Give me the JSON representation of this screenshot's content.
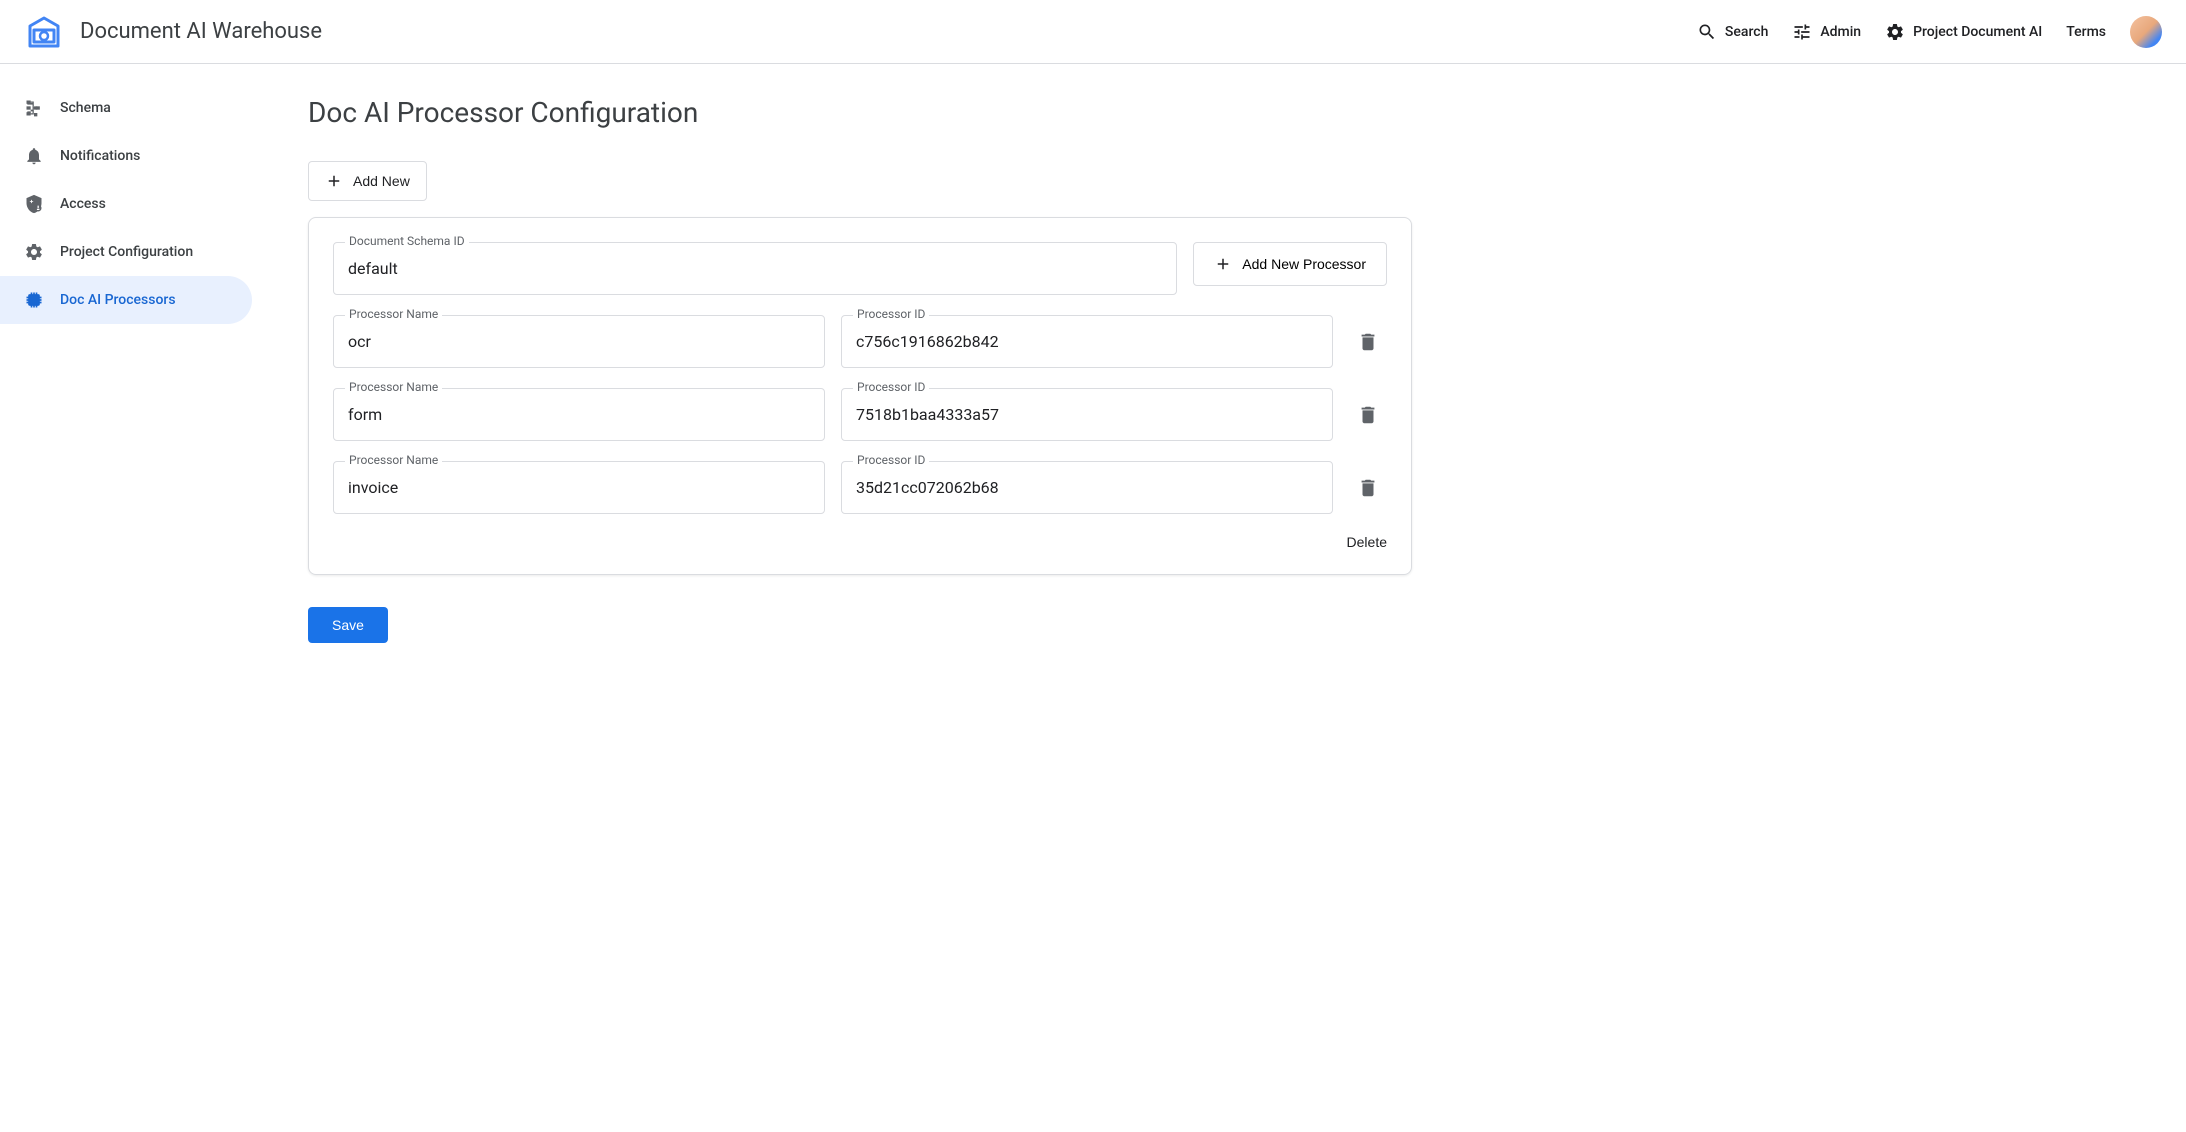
{
  "header": {
    "app_title": "Document AI Warehouse",
    "search_label": "Search",
    "admin_label": "Admin",
    "project_label": "Project Document AI",
    "terms_label": "Terms"
  },
  "sidebar": {
    "items": [
      {
        "label": "Schema"
      },
      {
        "label": "Notifications"
      },
      {
        "label": "Access"
      },
      {
        "label": "Project Configuration"
      },
      {
        "label": "Doc AI Processors"
      }
    ]
  },
  "main": {
    "page_title": "Doc AI Processor Configuration",
    "add_new_label": "Add New",
    "schema_field_label": "Document Schema ID",
    "schema_field_value": "default",
    "add_processor_label": "Add New Processor",
    "processor_name_label": "Processor Name",
    "processor_id_label": "Processor ID",
    "processors": [
      {
        "name": "ocr",
        "id": "c756c1916862b842"
      },
      {
        "name": "form",
        "id": "7518b1baa4333a57"
      },
      {
        "name": "invoice",
        "id": "35d21cc072062b68"
      }
    ],
    "delete_label": "Delete",
    "save_label": "Save"
  }
}
